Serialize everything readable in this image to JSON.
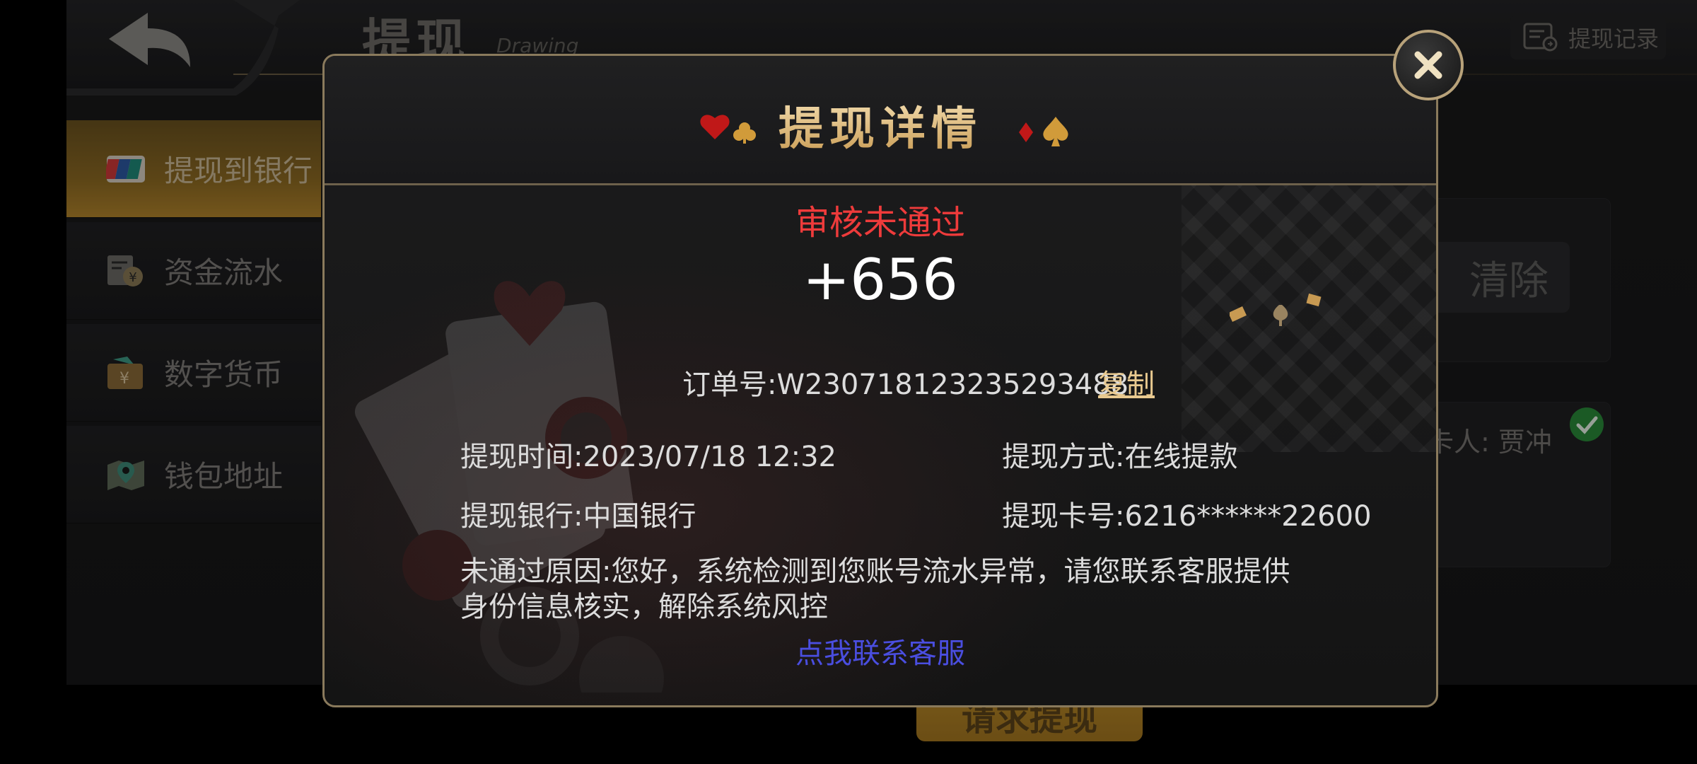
{
  "header": {
    "title": "提现",
    "subtitle": "Drawing",
    "records_label": "提现记录"
  },
  "sidebar": {
    "items": [
      {
        "label": "提现到银行",
        "icon": "unionpay-card-icon",
        "active": true
      },
      {
        "label": "资金流水",
        "icon": "ledger-yen-icon",
        "active": false
      },
      {
        "label": "数字货币",
        "icon": "wallet-yen-icon",
        "active": false
      },
      {
        "label": "钱包地址",
        "icon": "map-pin-icon",
        "active": false
      }
    ]
  },
  "background": {
    "clear_label": "清除",
    "cardholder": "卡人: 贾冲",
    "submit_label": "请求提现"
  },
  "modal": {
    "title": "提现详情",
    "status": "审核未通过",
    "amount": "+656",
    "order_label": "订单号:W230718123235293488",
    "copy_label": "复制",
    "time": "提现时间:2023/07/18 12:32",
    "method": "提现方式:在线提款",
    "bank": "提现银行:中国银行",
    "card": "提现卡号:6216******22600",
    "reason": "未通过原因:您好，系统检测到您账号流水异常，请您联系客服提供身份信息核实，解除系统风控",
    "contact_label": "点我联系客服"
  },
  "colors": {
    "status_red": "#ee3b3b",
    "link_blue": "#4a4ee0",
    "gold": "#e8c98f",
    "border_gold": "#8a7a5c"
  }
}
